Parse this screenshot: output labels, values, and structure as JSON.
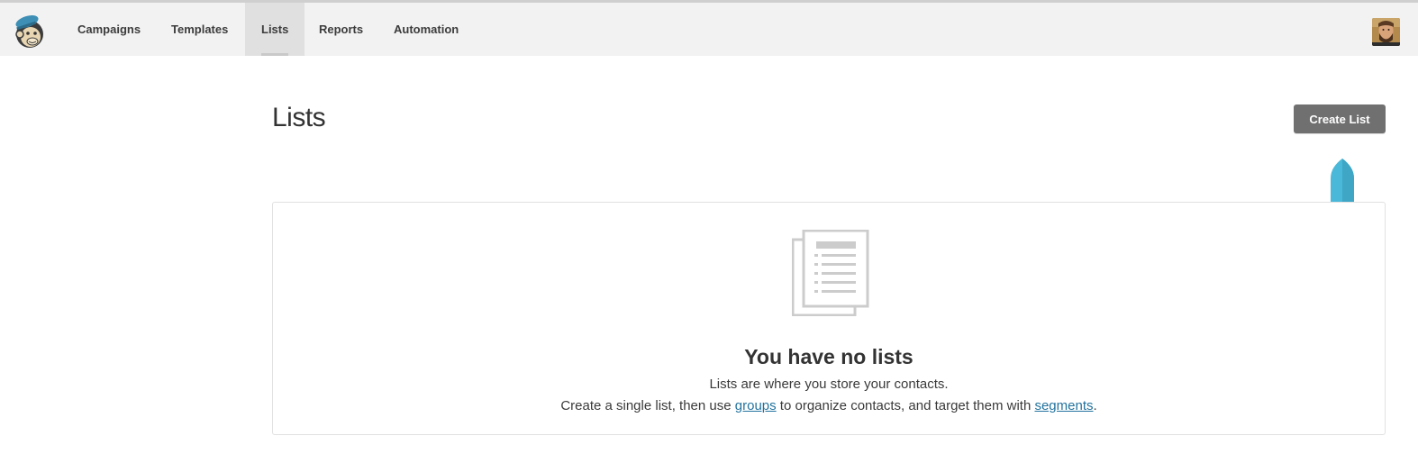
{
  "nav": {
    "items": [
      {
        "label": "Campaigns"
      },
      {
        "label": "Templates"
      },
      {
        "label": "Lists"
      },
      {
        "label": "Reports"
      },
      {
        "label": "Automation"
      }
    ],
    "active": "Lists"
  },
  "page": {
    "title": "Lists",
    "create_button_label": "Create List"
  },
  "empty_state": {
    "heading": "You have no lists",
    "line1": "Lists are where you store your contacts.",
    "line2_prefix": "Create a single list, then use ",
    "line2_link1": "groups",
    "line2_middle": " to organize contacts, and target them with ",
    "line2_link2": "segments",
    "line2_suffix": "."
  },
  "colors": {
    "nav_bg": "#f2f2f2",
    "button_bg": "#707070",
    "link": "#23739e",
    "pointer": "#4ab8d8"
  }
}
